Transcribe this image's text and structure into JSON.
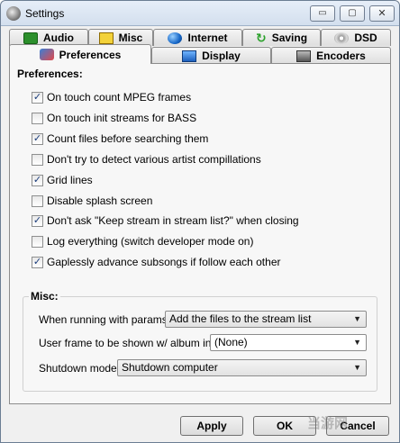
{
  "window": {
    "title": "Settings",
    "minimize": "▭",
    "maximize": "▢",
    "close": "✕"
  },
  "tabs_back": [
    {
      "label": "Audio",
      "icon": "audio-icon"
    },
    {
      "label": "Misc",
      "icon": "misc-icon"
    },
    {
      "label": "Internet",
      "icon": "internet-icon"
    },
    {
      "label": "Saving",
      "icon": "saving-icon"
    },
    {
      "label": "DSD",
      "icon": "dsd-icon"
    }
  ],
  "tabs_front": [
    {
      "label": "Preferences",
      "icon": "preferences-icon",
      "active": true
    },
    {
      "label": "Display",
      "icon": "display-icon"
    },
    {
      "label": "Encoders",
      "icon": "encoders-icon"
    }
  ],
  "preferences": {
    "group_title": "Preferences:",
    "options": [
      {
        "label": "On touch count MPEG frames",
        "checked": true,
        "mark": "✓"
      },
      {
        "label": "On touch init streams for BASS",
        "checked": false,
        "mark": ""
      },
      {
        "label": "Count files before searching them",
        "checked": true,
        "mark": "✓"
      },
      {
        "label": "Don't try to detect various artist compillations",
        "checked": false,
        "mark": ""
      },
      {
        "label": "Grid lines",
        "checked": true,
        "mark": "✓"
      },
      {
        "label": "Disable splash screen",
        "checked": false,
        "mark": ""
      },
      {
        "label": "Don't ask \"Keep stream in stream list?\" when closing",
        "checked": true,
        "mark": "✓"
      },
      {
        "label": "Log everything (switch developer mode on)",
        "checked": false,
        "mark": ""
      },
      {
        "label": "Gaplessly advance subsongs if follow each other",
        "checked": true,
        "mark": "✓"
      }
    ]
  },
  "misc": {
    "group_title": "Misc:",
    "params_label": "When running with params:",
    "params_value": "Add the files to the stream list",
    "frame_label": "User frame to be shown w/ album info:",
    "frame_value": "(None)",
    "shutdown_label": "Shutdown mode:",
    "shutdown_value": "Shutdown computer",
    "arrow": "▼"
  },
  "buttons": {
    "apply": "Apply",
    "ok": "OK",
    "cancel": "Cancel"
  },
  "watermark": "当游网"
}
